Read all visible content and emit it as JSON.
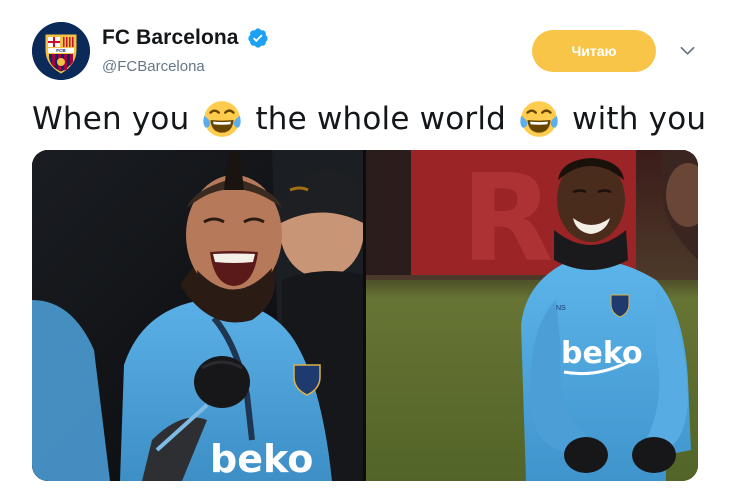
{
  "account": {
    "display_name": "FC Barcelona",
    "handle": "@FCBarcelona",
    "verified": true,
    "avatar_text": "FCB"
  },
  "follow_button": {
    "label": "Читаю",
    "color": "#f8c548"
  },
  "more_menu": {
    "icon": "chevron-down-icon"
  },
  "tweet": {
    "segment_1": "When you",
    "emoji_1": "face-with-tears-of-joy",
    "segment_2": "the whole world",
    "emoji_2": "face-with-tears-of-joy",
    "segment_3": "with you"
  },
  "media": {
    "left_photo": {
      "shirt_sponsor": "beko"
    },
    "right_photo": {
      "shirt_sponsor": "beko",
      "shirt_initials": "NS"
    }
  },
  "colors": {
    "text": "#14171a",
    "secondary_text": "#657786",
    "verified_blue": "#1da1f2",
    "shirt_blue": "#4fa4dc"
  }
}
